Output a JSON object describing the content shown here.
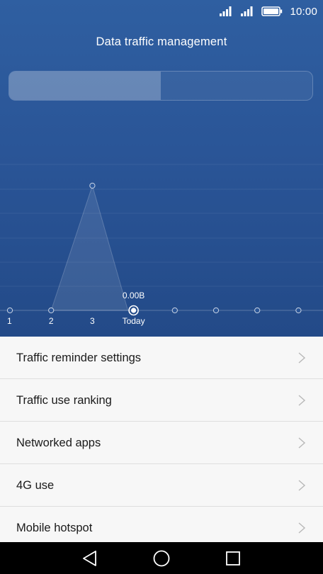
{
  "status_bar": {
    "time": "10:00",
    "icons": [
      "signal-icon",
      "signal-icon",
      "battery-icon"
    ]
  },
  "header": {
    "title": "Data traffic management"
  },
  "usage_bar": {
    "fill_fraction": 0.5
  },
  "chart_data": {
    "type": "line",
    "categories": [
      "1",
      "2",
      "3",
      "Today",
      "",
      "",
      "",
      ""
    ],
    "values": [
      0,
      0,
      1,
      0,
      0,
      0,
      0,
      0
    ],
    "selected_index": 3,
    "selected_value_label": "0.00B",
    "title": "",
    "xlabel": "",
    "ylabel": "",
    "ylim": [
      0,
      1.1
    ],
    "grid": true
  },
  "menu": {
    "items": [
      {
        "label": "Traffic reminder settings"
      },
      {
        "label": "Traffic use ranking"
      },
      {
        "label": "Networked apps"
      },
      {
        "label": "4G use"
      },
      {
        "label": "Mobile hotspot"
      }
    ]
  },
  "colors": {
    "header_blue": "#2a5597",
    "list_background": "#f7f7f7",
    "nav_background": "#000000"
  },
  "navigation": {
    "icons": [
      "back-icon",
      "home-icon",
      "recents-icon"
    ]
  }
}
